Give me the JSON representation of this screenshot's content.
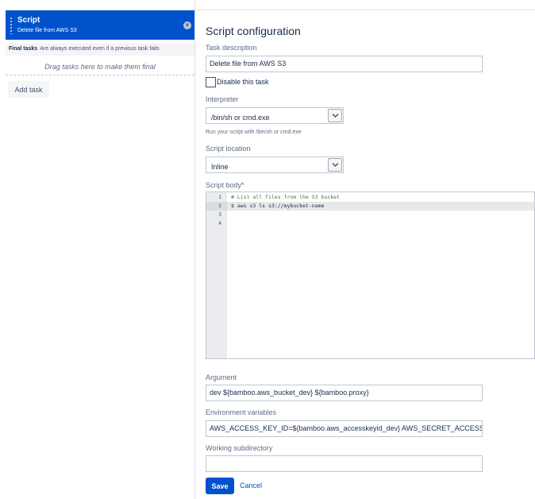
{
  "tasks": {
    "selected": {
      "title": "Script",
      "subtitle": "Delete file from AWS S3"
    },
    "final_tasks": {
      "label": "Final tasks",
      "description": "Are always executed even if a previous task fails"
    },
    "drop_zone": "Drag tasks here to make them final",
    "add_task_label": "Add task"
  },
  "form": {
    "heading": "Script configuration",
    "task_description": {
      "label": "Task description",
      "value": "Delete file from AWS S3"
    },
    "disable_task": {
      "label": "Disable this task",
      "checked": false
    },
    "interpreter": {
      "label": "Interpreter",
      "value": "/bin/sh or cmd.exe",
      "hint": "Run your script with /bin/sh or cmd.exe"
    },
    "script_location": {
      "label": "Script location",
      "value": "Inline"
    },
    "script_body": {
      "label": "Script body",
      "required_mark": "*",
      "lines": [
        {
          "number": "1",
          "text": "# List all files from the S3 bucket"
        },
        {
          "number": "2",
          "text": "$ aws s3 ls s3://mybucket-name"
        },
        {
          "number": "3",
          "text": ""
        },
        {
          "number": "4",
          "text": ""
        }
      ]
    },
    "argument": {
      "label": "Argument",
      "value": "dev ${bamboo.aws_bucket_dev} ${bamboo.proxy}"
    },
    "environment_variables": {
      "label": "Environment variables",
      "value": "AWS_ACCESS_KEY_ID=${bamboo.aws_accesskeyid_dev} AWS_SECRET_ACCESS_"
    },
    "working_subdirectory": {
      "label": "Working subdirectory",
      "value": ""
    },
    "save_label": "Save",
    "cancel_label": "Cancel"
  },
  "icons": {
    "drag": "drag-handle-icon",
    "remove": "close-icon",
    "dropdown": "chevron-down-icon"
  },
  "colors": {
    "accent": "#0052cc",
    "comment": "#3a7a3a",
    "required": "#de350b"
  }
}
